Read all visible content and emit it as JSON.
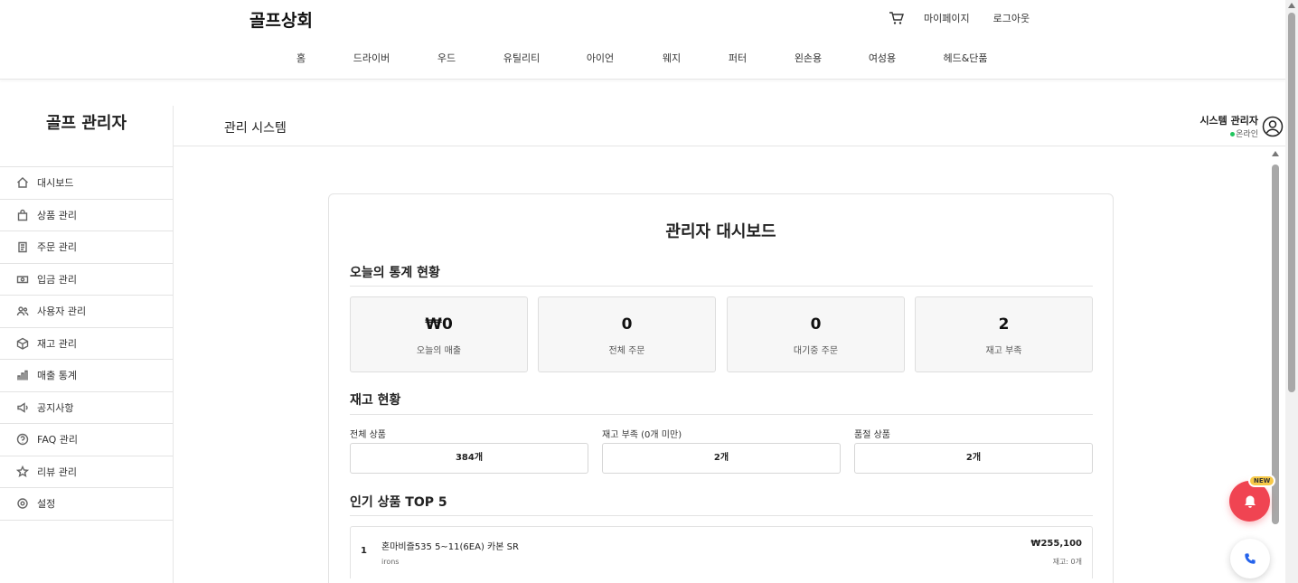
{
  "header": {
    "brand": "골프상회",
    "links": {
      "mypage": "마이페이지",
      "logout": "로그아웃"
    },
    "nav": [
      "홈",
      "드라이버",
      "우드",
      "유틸리티",
      "아이언",
      "웨지",
      "퍼터",
      "왼손용",
      "여성용",
      "헤드&단품"
    ]
  },
  "sidebar": {
    "title": "골프 관리자",
    "items": [
      {
        "label": "대시보드",
        "icon": "home-icon"
      },
      {
        "label": "상품 관리",
        "icon": "bag-icon"
      },
      {
        "label": "주문 관리",
        "icon": "clipboard-icon"
      },
      {
        "label": "입금 관리",
        "icon": "money-icon"
      },
      {
        "label": "사용자 관리",
        "icon": "users-icon"
      },
      {
        "label": "재고 관리",
        "icon": "box-icon"
      },
      {
        "label": "매출 통계",
        "icon": "bar-chart-icon"
      },
      {
        "label": "공지사항",
        "icon": "megaphone-icon"
      },
      {
        "label": "FAQ 관리",
        "icon": "help-icon"
      },
      {
        "label": "리뷰 관리",
        "icon": "star-icon"
      },
      {
        "label": "설정",
        "icon": "settings-icon"
      }
    ]
  },
  "admin_header": {
    "title": "관리 시스템",
    "user_name": "시스템 관리자",
    "user_status": "온라인"
  },
  "dashboard": {
    "title": "관리자 대시보드",
    "today_section": "오늘의 통계 현황",
    "stats": [
      {
        "value": "₩0",
        "label": "오늘의 매출"
      },
      {
        "value": "0",
        "label": "전체 주문"
      },
      {
        "value": "0",
        "label": "대기중 주문"
      },
      {
        "value": "2",
        "label": "재고 부족"
      }
    ],
    "inventory_section": "재고 현황",
    "inventory": [
      {
        "label": "전체 상품",
        "value": "384개"
      },
      {
        "label": "재고 부족 (0개 미만)",
        "value": "2개"
      },
      {
        "label": "품절 상품",
        "value": "2개"
      }
    ],
    "top_section": "인기 상품 TOP 5",
    "top_products": [
      {
        "rank": "1",
        "name": "혼마비즐535 5~11(6EA) 카본 SR",
        "category": "irons",
        "price": "₩255,100",
        "stock": "재고: 0개"
      }
    ]
  },
  "floating": {
    "badge": "NEW"
  }
}
